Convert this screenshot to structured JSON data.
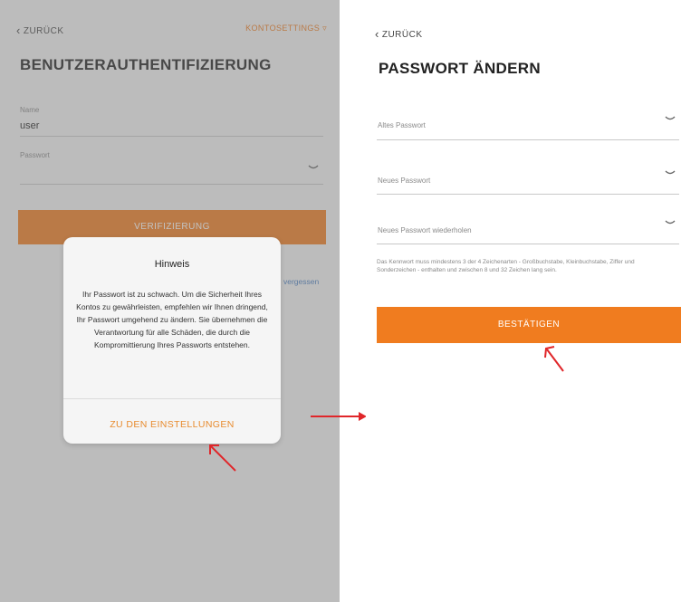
{
  "left_screen": {
    "back_label": "ZURÜCK",
    "header_link": "KONTOSETTINGS",
    "title": "BENUTZERAUTHENTIFIZIERUNG",
    "name_field": {
      "label": "Name",
      "value": "user"
    },
    "password_field": {
      "label": "Passwort",
      "value": ""
    },
    "verify_button": "VERIFIZIERUNG",
    "forgot_link": "vergessen"
  },
  "dialog": {
    "title": "Hinweis",
    "body": "Ihr Passwort ist zu schwach. Um die Sicherheit Ihres Kontos zu gewährleisten, empfehlen wir Ihnen dringend, Ihr Passwort umgehend zu ändern. Sie übernehmen die Verantwortung für alle Schäden, die durch die Kompromittierung Ihres Passworts entstehen.",
    "action": "ZU DEN EINSTELLUNGEN"
  },
  "right_screen": {
    "back_label": "ZURÜCK",
    "title": "PASSWORT ÄNDERN",
    "old_password_placeholder": "Altes Passwort",
    "new_password_placeholder": "Neues Passwort",
    "repeat_password_placeholder": "Neues Passwort wiederholen",
    "hint": "Das Kennwort muss mindestens 3 der 4 Zeichenarten - Großbuchstabe, Kleinbuchstabe, Ziffer und Sonderzeichen - enthalten und zwischen 8 und 32 Zeichen lang sein.",
    "confirm_button": "BESTÄTIGEN"
  },
  "colors": {
    "accent": "#f07c1f",
    "annotation_arrow": "#e0262a",
    "link": "#4a7fc1"
  },
  "icons": [
    "chevron-left-icon",
    "eye-closed-icon",
    "arrow-right-icon",
    "pointer-arrow-icon"
  ]
}
